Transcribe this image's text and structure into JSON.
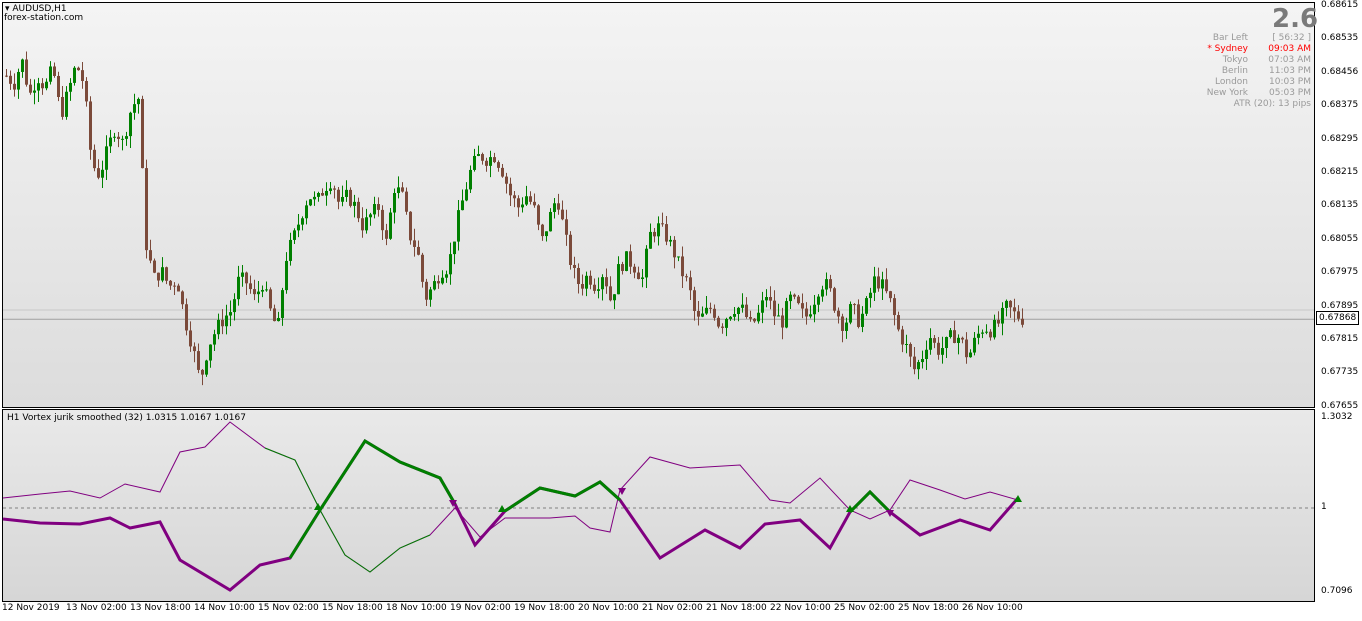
{
  "symbol_title": "AUDUSD,H1",
  "watermark": "forex-station.com",
  "big_number": "2.6",
  "session_panel": [
    {
      "name": "Bar Left",
      "value": "[ 56:32 ]",
      "color": "#9a9a9a"
    },
    {
      "name": "* Sydney",
      "value": "09:03 AM",
      "color": "#ff0000"
    },
    {
      "name": "Tokyo",
      "value": "07:03 AM",
      "color": "#9a9a9a"
    },
    {
      "name": "Berlin",
      "value": "11:03 PM",
      "color": "#9a9a9a"
    },
    {
      "name": "London",
      "value": "10:03 PM",
      "color": "#9a9a9a"
    },
    {
      "name": "New York",
      "value": "05:03 PM",
      "color": "#9a9a9a"
    }
  ],
  "atr_text": "ATR (20): 13 pips",
  "price_axis": [
    "0.68615",
    "0.68535",
    "0.68456",
    "0.68375",
    "0.68295",
    "0.68215",
    "0.68135",
    "0.68055",
    "0.67975",
    "0.67895",
    "0.67815",
    "0.67735",
    "0.67655"
  ],
  "current_price": "0.67868",
  "indicator_title": "H1 Vortex jurik smoothed (32) 1.0315 1.0167 1.0167",
  "indicator_axis": [
    "1.3032",
    "1",
    "0.7096"
  ],
  "time_axis": [
    "12 Nov 2019",
    "13 Nov 02:00",
    "13 Nov 18:00",
    "14 Nov 10:00",
    "15 Nov 02:00",
    "15 Nov 18:00",
    "18 Nov 10:00",
    "19 Nov 02:00",
    "19 Nov 18:00",
    "20 Nov 10:00",
    "21 Nov 02:00",
    "21 Nov 18:00",
    "22 Nov 10:00",
    "25 Nov 02:00",
    "25 Nov 18:00",
    "26 Nov 10:00"
  ],
  "colors": {
    "up": "#008000",
    "down": "#7b4a3a",
    "vi_plus": "#008000",
    "vi_minus": "#800080"
  },
  "chart_data": {
    "type": "candlestick",
    "title": "AUDUSD,H1",
    "ylim": [
      0.67655,
      0.68655
    ],
    "close_path": [
      0.6848,
      0.6846,
      0.6852,
      0.6843,
      0.6848,
      0.6845,
      0.685,
      0.6838,
      0.6844,
      0.6851,
      0.6846,
      0.6826,
      0.6823,
      0.6829,
      0.6835,
      0.6831,
      0.6839,
      0.6843,
      0.6806,
      0.6797,
      0.6799,
      0.6795,
      0.6797,
      0.6787,
      0.678,
      0.6771,
      0.678,
      0.6784,
      0.6787,
      0.6789,
      0.6797,
      0.6796,
      0.6792,
      0.6796,
      0.6789,
      0.6784,
      0.6802,
      0.6807,
      0.6813,
      0.6818,
      0.6816,
      0.682,
      0.6822,
      0.6815,
      0.6818,
      0.6815,
      0.681,
      0.6813,
      0.6815,
      0.6806,
      0.682,
      0.6818,
      0.6808,
      0.6804,
      0.6792,
      0.6795,
      0.6799,
      0.68,
      0.681,
      0.6818,
      0.6825,
      0.6828,
      0.6827,
      0.6828,
      0.6824,
      0.6818,
      0.6815,
      0.6818,
      0.6815,
      0.6806,
      0.6812,
      0.6818,
      0.6808,
      0.6799,
      0.6795,
      0.6798,
      0.6795,
      0.6799,
      0.6791,
      0.68,
      0.6802,
      0.68,
      0.6797,
      0.6808,
      0.681,
      0.6808,
      0.6804,
      0.6799,
      0.6795,
      0.6786,
      0.6788,
      0.679,
      0.6785,
      0.6788,
      0.679,
      0.6789,
      0.6785,
      0.6788,
      0.6793,
      0.6788,
      0.6786,
      0.6792,
      0.679,
      0.6787,
      0.6791,
      0.6796,
      0.6795,
      0.6789,
      0.6785,
      0.679,
      0.6786,
      0.6791,
      0.6797,
      0.6795,
      0.6791,
      0.6784,
      0.678,
      0.6774,
      0.6777,
      0.6783,
      0.6779,
      0.678,
      0.6783,
      0.6782,
      0.6777,
      0.6782,
      0.6785,
      0.6784,
      0.6786,
      0.679,
      0.6788,
      0.6787
    ]
  }
}
